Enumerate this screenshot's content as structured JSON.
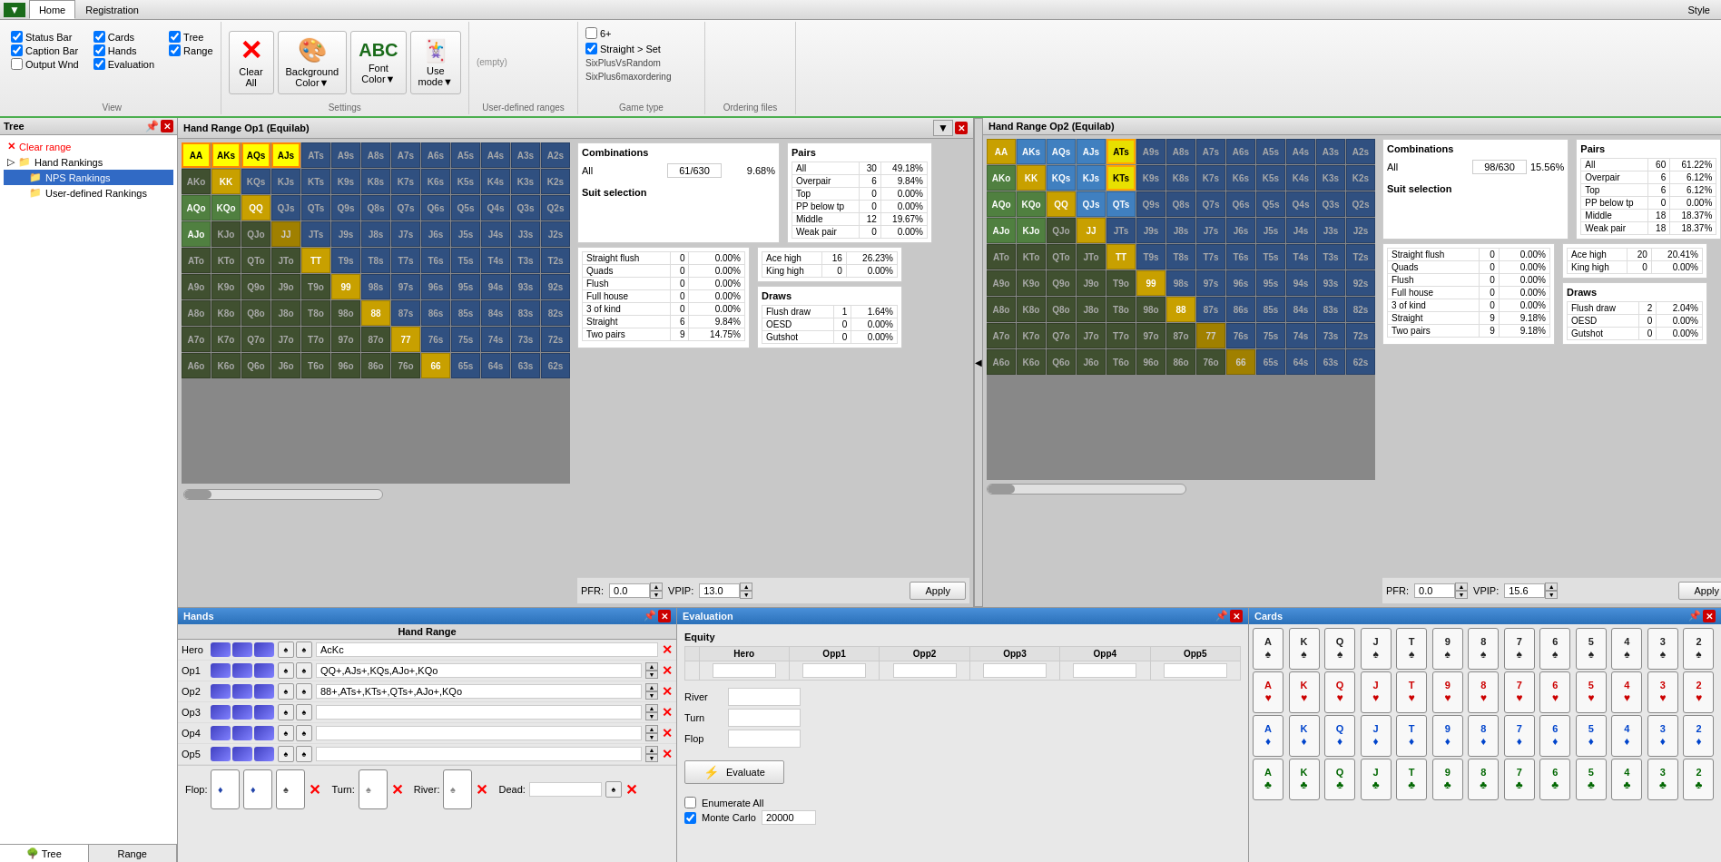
{
  "menubar": {
    "logo": "▼",
    "tabs": [
      "Home",
      "Registration"
    ],
    "active_tab": "Home",
    "style_btn": "Style"
  },
  "ribbon": {
    "view_group": {
      "label": "View",
      "checks": [
        {
          "id": "status_bar",
          "label": "Status Bar",
          "checked": true
        },
        {
          "id": "cards",
          "label": "Cards",
          "checked": true
        },
        {
          "id": "tree",
          "label": "Tree",
          "checked": true
        },
        {
          "id": "caption_bar",
          "label": "Caption Bar",
          "checked": true
        },
        {
          "id": "hands",
          "label": "Hands",
          "checked": true
        },
        {
          "id": "range",
          "label": "Range",
          "checked": true
        },
        {
          "id": "output_wnd",
          "label": "Output Wnd",
          "checked": false
        },
        {
          "id": "evaluation",
          "label": "Evaluation",
          "checked": true
        }
      ]
    },
    "clear_all_btn": "Clear All",
    "background_color_btn": "Background Color",
    "font_color_btn": "Font Color",
    "use_mode_btn": "Use mode",
    "settings_group": "Settings",
    "user_defined_ranges_group": "User-defined ranges",
    "game_type_checks": [
      {
        "id": "six_plus",
        "label": "6+",
        "checked": false
      },
      {
        "id": "straight_set",
        "label": "Straight > Set",
        "checked": true
      }
    ],
    "game_type_options": [
      "SixPlusVsRandom",
      "SixPlus6maxordering"
    ],
    "ordering_files_label": "Ordering files"
  },
  "tree_panel": {
    "title": "Tree",
    "clear_range": "Clear range",
    "items": [
      {
        "label": "Hand Rankings",
        "icon": "folder",
        "level": 0
      },
      {
        "label": "NPS Rankings",
        "icon": "folder",
        "level": 1,
        "selected": true
      },
      {
        "label": "User-defined Rankings",
        "icon": "folder",
        "level": 1
      }
    ],
    "tabs": [
      "Tree",
      "Range"
    ]
  },
  "hand_range_op1": {
    "title": "Hand Range Op1 (Equilab)",
    "combinations": {
      "label": "Combinations",
      "all_label": "All",
      "all_value": "61/630",
      "all_pct": "9.68%"
    },
    "stats": {
      "pairs": {
        "title": "Pairs",
        "rows": [
          {
            "label": "All",
            "value": "30",
            "pct": "49.18%"
          },
          {
            "label": "Overpair",
            "value": "6",
            "pct": "9.84%"
          },
          {
            "label": "Top",
            "value": "0",
            "pct": "0.00%"
          },
          {
            "label": "PP below tp",
            "value": "0",
            "pct": "0.00%"
          },
          {
            "label": "Middle",
            "value": "12",
            "pct": "19.67%"
          },
          {
            "label": "Weak pair",
            "value": "0",
            "pct": "0.00%"
          }
        ]
      },
      "made_hands": {
        "rows": [
          {
            "label": "Straight flush",
            "value": "0",
            "pct": "0.00%"
          },
          {
            "label": "Quads",
            "value": "0",
            "pct": "0.00%"
          },
          {
            "label": "Flush",
            "value": "0",
            "pct": "0.00%"
          },
          {
            "label": "Full house",
            "value": "0",
            "pct": "0.00%"
          },
          {
            "label": "3 of kind",
            "value": "0",
            "pct": "0.00%"
          },
          {
            "label": "Straight",
            "value": "6",
            "pct": "9.84%"
          },
          {
            "label": "Two pairs",
            "value": "9",
            "pct": "14.75%"
          }
        ]
      },
      "ace_king": {
        "rows": [
          {
            "label": "Ace high",
            "value": "16",
            "pct": "26.23%"
          },
          {
            "label": "King high",
            "value": "0",
            "pct": "0.00%"
          }
        ]
      },
      "draws": {
        "title": "Draws",
        "rows": [
          {
            "label": "Flush draw",
            "value": "1",
            "pct": "1.64%"
          },
          {
            "label": "OESD",
            "value": "0",
            "pct": "0.00%"
          },
          {
            "label": "Gutshot",
            "value": "0",
            "pct": "0.00%"
          }
        ]
      }
    },
    "pfr": "0.0",
    "vpip": "13.0",
    "apply_btn": "Apply"
  },
  "hand_range_op2": {
    "title": "Hand Range Op2 (Equilab)",
    "combinations": {
      "all_value": "98/630",
      "all_pct": "15.56%"
    },
    "stats": {
      "pairs": {
        "rows": [
          {
            "label": "All",
            "value": "60",
            "pct": "61.22%"
          },
          {
            "label": "Overpair",
            "value": "6",
            "pct": "6.12%"
          },
          {
            "label": "Top",
            "value": "6",
            "pct": "6.12%"
          },
          {
            "label": "PP below tp",
            "value": "0",
            "pct": "0.00%"
          },
          {
            "label": "Middle",
            "value": "18",
            "pct": "18.37%"
          },
          {
            "label": "Weak pair",
            "value": "18",
            "pct": "18.37%"
          }
        ]
      },
      "made_hands": {
        "rows": [
          {
            "label": "Straight flush",
            "value": "0",
            "pct": "0.00%"
          },
          {
            "label": "Quads",
            "value": "0",
            "pct": "0.00%"
          },
          {
            "label": "Flush",
            "value": "0",
            "pct": "0.00%"
          },
          {
            "label": "Full house",
            "value": "0",
            "pct": "0.00%"
          },
          {
            "label": "3 of kind",
            "value": "0",
            "pct": "0.00%"
          },
          {
            "label": "Straight",
            "value": "9",
            "pct": "9.18%"
          },
          {
            "label": "Two pairs",
            "value": "9",
            "pct": "9.18%"
          }
        ]
      },
      "ace_king": {
        "rows": [
          {
            "label": "Ace high",
            "value": "20",
            "pct": "20.41%"
          },
          {
            "label": "King high",
            "value": "0",
            "pct": "0.00%"
          }
        ]
      },
      "draws": {
        "rows": [
          {
            "label": "Flush draw",
            "value": "2",
            "pct": "2.04%"
          },
          {
            "label": "OESD",
            "value": "0",
            "pct": "0.00%"
          },
          {
            "label": "Gutshot",
            "value": "0",
            "pct": "0.00%"
          }
        ]
      }
    },
    "pfr": "0.0",
    "vpip": "15.6",
    "apply_btn": "Apply"
  },
  "hands_panel": {
    "title": "Hands",
    "hand_range_label": "Hand Range",
    "hero": {
      "label": "Hero",
      "value": "AcKc"
    },
    "opponents": [
      {
        "label": "Op1",
        "value": "QQ+,AJs+,KQs,AJo+,KQo"
      },
      {
        "label": "Op2",
        "value": "88+,ATs+,KTs+,QTs+,AJo+,KQo"
      },
      {
        "label": "Op3",
        "value": ""
      },
      {
        "label": "Op4",
        "value": ""
      },
      {
        "label": "Op5",
        "value": ""
      }
    ],
    "flop": {
      "label": "Flop:"
    },
    "turn": {
      "label": "Turn:"
    },
    "river": {
      "label": "River:"
    },
    "dead": {
      "label": "Dead:"
    }
  },
  "evaluation_panel": {
    "title": "Evaluation",
    "equity_label": "Equity",
    "columns": [
      "Hero",
      "Opp1",
      "Opp2",
      "Opp3",
      "Opp4",
      "Opp5"
    ],
    "river_label": "River",
    "turn_label": "Turn",
    "flop_label": "Flop",
    "evaluate_btn": "Evaluate",
    "enumerate_all": "Enumerate All",
    "monte_carlo": "Monte Carlo",
    "monte_carlo_value": "20000"
  },
  "cards_panel": {
    "title": "Cards",
    "cards": {
      "spades": [
        "A♠",
        "K♠",
        "Q♠",
        "J♠",
        "T♠",
        "9♠",
        "8♠",
        "7♠",
        "6♠"
      ],
      "hearts": [
        "A♥",
        "K♥",
        "Q♥",
        "J♥",
        "T♥",
        "9♥",
        "8♥",
        "7♥",
        "6♥"
      ],
      "diamonds": [
        "A♦",
        "K♦",
        "Q♦",
        "J♦",
        "T♦",
        "9♦",
        "8♦",
        "7♦",
        "6♦"
      ],
      "clubs": [
        "A♣",
        "K♣",
        "Q♣",
        "J♣",
        "T♣",
        "9♣",
        "8♣",
        "7♣",
        "6♣"
      ]
    }
  },
  "grid_op1": [
    [
      "AA",
      "AKs",
      "AQs",
      "AJs",
      "ATs",
      "A9s",
      "A8s",
      "A7s",
      "A6s",
      "A5s",
      "A4s",
      "A3s",
      "A2s"
    ],
    [
      "AKo",
      "KK",
      "KQs",
      "KJs",
      "KTs",
      "K9s",
      "K8s",
      "K7s",
      "K6s",
      "K5s",
      "K4s",
      "K3s",
      "K2s"
    ],
    [
      "AQo",
      "KQo",
      "QQ",
      "QJs",
      "QTs",
      "Q9s",
      "Q8s",
      "Q7s",
      "Q6s",
      "Q5s",
      "Q4s",
      "Q3s",
      "Q2s"
    ],
    [
      "AJo",
      "KJo",
      "QJo",
      "JJ",
      "JTs",
      "J9s",
      "J8s",
      "J7s",
      "J6s",
      "J5s",
      "J4s",
      "J3s",
      "J2s"
    ],
    [
      "ATo",
      "KTo",
      "QTo",
      "JTo",
      "TT",
      "T9s",
      "T8s",
      "T7s",
      "T6s",
      "T5s",
      "T4s",
      "T3s",
      "T2s"
    ],
    [
      "A9o",
      "K9o",
      "Q9o",
      "J9o",
      "T9o",
      "99",
      "98s",
      "97s",
      "96s",
      "95s",
      "94s",
      "93s",
      "92s"
    ],
    [
      "A8o",
      "K8o",
      "Q8o",
      "J8o",
      "T8o",
      "98o",
      "88",
      "87s",
      "86s",
      "85s",
      "84s",
      "83s",
      "82s"
    ],
    [
      "A7o",
      "K7o",
      "Q7o",
      "J7o",
      "T7o",
      "97o",
      "87o",
      "77",
      "76s",
      "75s",
      "74s",
      "73s",
      "72s"
    ],
    [
      "A6o",
      "K6o",
      "Q6o",
      "J6o",
      "T6o",
      "96o",
      "86o",
      "76o",
      "66",
      "65s",
      "64s",
      "63s",
      "62s"
    ]
  ],
  "hand_cell_colors_op1": {
    "AA": "pair-sel",
    "AKs": "suited-sel",
    "AQs": "suited-sel",
    "AJs": "suited-sel",
    "ATs": "suited",
    "A9s": "suited",
    "A8s": "suited",
    "A7s": "suited",
    "A6s": "suited",
    "AKo": "offsuit",
    "KK": "pair-sel",
    "KQs": "suited",
    "KJs": "suited",
    "KTs": "suited",
    "K9s": "suited",
    "K8s": "suited",
    "K7s": "suited",
    "K6s": "suited",
    "AQo": "offsuit-sel",
    "KQo": "offsuit-sel",
    "QQ": "pair-sel",
    "QJs": "suited",
    "QTs": "suited",
    "Q9s": "suited",
    "Q8s": "suited",
    "Q7s": "suited",
    "Q6s": "suited",
    "AJo": "offsuit-sel",
    "KJo": "offsuit",
    "QJo": "offsuit",
    "JJ": "pair",
    "JTs": "suited",
    "J9s": "suited",
    "J8s": "suited",
    "J7s": "suited",
    "J6s": "suited",
    "ATo": "offsuit",
    "KTo": "offsuit",
    "QTo": "offsuit",
    "JTo": "offsuit",
    "TT": "pair-sel",
    "T9s": "suited",
    "T8s": "suited",
    "T7s": "suited",
    "T6s": "suited",
    "A9o": "offsuit",
    "K9o": "offsuit",
    "Q9o": "offsuit",
    "J9o": "offsuit",
    "T9o": "offsuit",
    "99": "pair-sel",
    "98s": "suited",
    "97s": "suited",
    "96s": "suited",
    "A8o": "offsuit",
    "K8o": "offsuit",
    "Q8o": "offsuit",
    "J8o": "offsuit",
    "T8o": "offsuit",
    "98o": "offsuit",
    "88": "pair-sel",
    "87s": "suited",
    "86s": "suited",
    "A7o": "offsuit",
    "K7o": "offsuit",
    "Q7o": "offsuit",
    "J7o": "offsuit",
    "T7o": "offsuit",
    "97o": "offsuit",
    "87o": "offsuit",
    "77": "pair-sel",
    "76s": "suited",
    "A6o": "offsuit",
    "K6o": "offsuit",
    "Q6o": "offsuit",
    "J6o": "offsuit",
    "T6o": "offsuit",
    "96o": "offsuit",
    "86o": "offsuit",
    "76o": "offsuit",
    "66": "pair-sel"
  }
}
